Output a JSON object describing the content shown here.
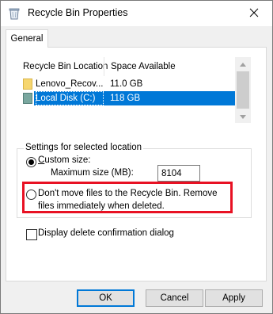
{
  "window": {
    "title": "Recycle Bin Properties",
    "title_icon": "recycle-bin-icon",
    "close_icon": "close-icon"
  },
  "tabs": [
    {
      "label": "General",
      "selected": true
    }
  ],
  "locations": {
    "columns": [
      "Recycle Bin Location",
      "Space Available"
    ],
    "rows": [
      {
        "name": "Lenovo_Recov...",
        "space": "11.0 GB",
        "icon": "folder-drive-icon",
        "selected": false
      },
      {
        "name": "Local Disk (C:)",
        "space": "118 GB",
        "icon": "local-disk-icon",
        "selected": true
      }
    ]
  },
  "settings": {
    "group_label": "Settings for selected location",
    "custom_size_label": "Custom size:",
    "custom_size_selected": true,
    "max_size_label": "Maximum size (MB):",
    "max_size_value": "8104",
    "dont_move_label": "Don't move files to the Recycle Bin. Remove files immediately when deleted.",
    "dont_move_selected": false
  },
  "confirm": {
    "label": "Display delete confirmation dialog",
    "checked": false
  },
  "buttons": {
    "ok": "OK",
    "cancel": "Cancel",
    "apply": "Apply"
  },
  "colors": {
    "selection": "#0078d7",
    "highlight_box": "#e81123",
    "default_button_border": "#0078d7"
  }
}
